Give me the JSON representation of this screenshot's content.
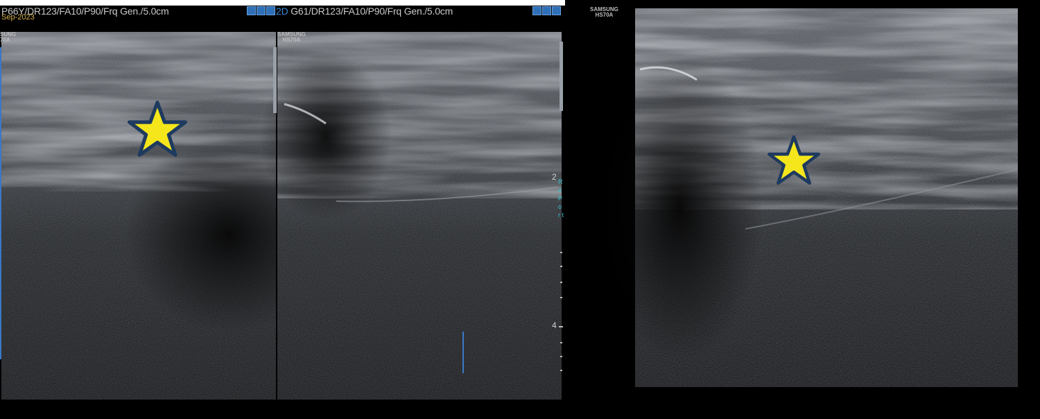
{
  "panel_left": {
    "header_a": "P66Y/DR123/FA10/P90/Frq Gen./5.0cm",
    "header_b_mode": "2D",
    "header_b": "G61/DR123/FA10/P90/Frq Gen./5.0cm",
    "date": "Sep-2023",
    "badge_a": "SUNG\n70A",
    "badge_b": "SAMSUNG\nHS70A",
    "depth_labels": [
      "2",
      "4"
    ],
    "side_text": "Re Po r t"
  },
  "panel_right": {
    "badge": "SAMSUNG\nHS70A"
  },
  "colors": {
    "star_fill": "#f5e61c",
    "star_outline": "#1e3a5f",
    "header_text": "#c9c9c9",
    "date_text": "#d7b24a",
    "accent_blue": "#3a86d6"
  },
  "icons": [
    "star-marker-icon",
    "mode-icon"
  ]
}
